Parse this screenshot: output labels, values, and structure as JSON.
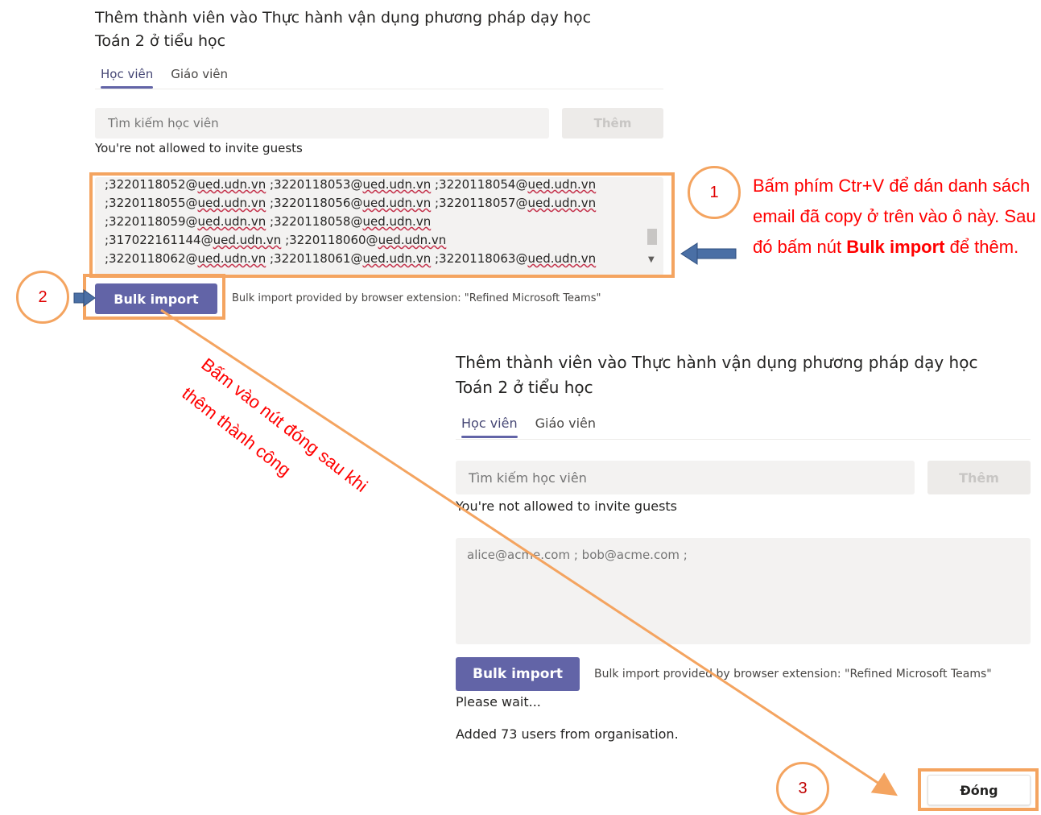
{
  "panel_top": {
    "title_line1": "Thêm thành viên vào Thực hành vận dụng phương pháp dạy học",
    "title_line2": "Toán 2 ở tiểu học",
    "tab_students": "Học viên",
    "tab_teachers": "Giáo viên",
    "search_placeholder": "Tìm kiếm học viên",
    "add_label": "Thêm",
    "guest_note": "You're not allowed to invite guests",
    "email_lines": [
      [
        ";3220118052@",
        "ued.udn.vn",
        " ;3220118053@",
        "ued.udn.vn",
        " ;3220118054@",
        "ued.udn.vn"
      ],
      [
        ";3220118055@",
        "ued.udn.vn",
        " ;3220118056@",
        "ued.udn.vn",
        " ;3220118057@",
        "ued.udn.vn"
      ],
      [
        ";3220118059@",
        "ued.udn.vn",
        " ;3220118058@",
        "ued.udn.vn",
        "",
        ""
      ],
      [
        ";317022161144@",
        "ued.udn.vn",
        " ;3220118060@",
        "ued.udn.vn",
        "",
        ""
      ],
      [
        ";3220118062@",
        "ued.udn.vn",
        " ;3220118061@",
        "ued.udn.vn",
        " ;3220118063@",
        "ued.udn.vn"
      ]
    ],
    "bulk_label": "Bulk import",
    "bulk_note": "Bulk import provided by browser extension: \"Refined Microsoft Teams\""
  },
  "panel_bottom": {
    "title_line1": "Thêm thành viên vào Thực hành vận dụng phương pháp dạy học",
    "title_line2": "Toán 2 ở tiểu học",
    "tab_students": "Học viên",
    "tab_teachers": "Giáo viên",
    "search_placeholder": "Tìm kiếm học viên",
    "add_label": "Thêm",
    "guest_note": "You're not allowed to invite guests",
    "textarea_placeholder": "alice@acme.com ; bob@acme.com ;",
    "bulk_label": "Bulk import",
    "bulk_note": "Bulk import provided by browser extension: \"Refined Microsoft Teams\"",
    "status_wait": "Please wait...",
    "status_added": "Added 73 users from organisation.",
    "close_label": "Đóng"
  },
  "annotations": {
    "step1": "1",
    "step2": "2",
    "step3": "3",
    "instruction_part1": "Bấm phím Ctr+V để dán danh sách email đã copy ở trên vào ô này. Sau đó bấm nút",
    "instruction_bold1": "Bulk",
    "instruction_bold2": "import",
    "instruction_part2": "để thêm.",
    "diagonal_line1": "Bấm vào nút đóng sau khi",
    "diagonal_line2": "thêm thành công",
    "accent_orange": "#f4a460",
    "annotation_red": "#ff0000",
    "arrow_blue": "#4a6fa5",
    "teams_purple": "#6264a7"
  }
}
